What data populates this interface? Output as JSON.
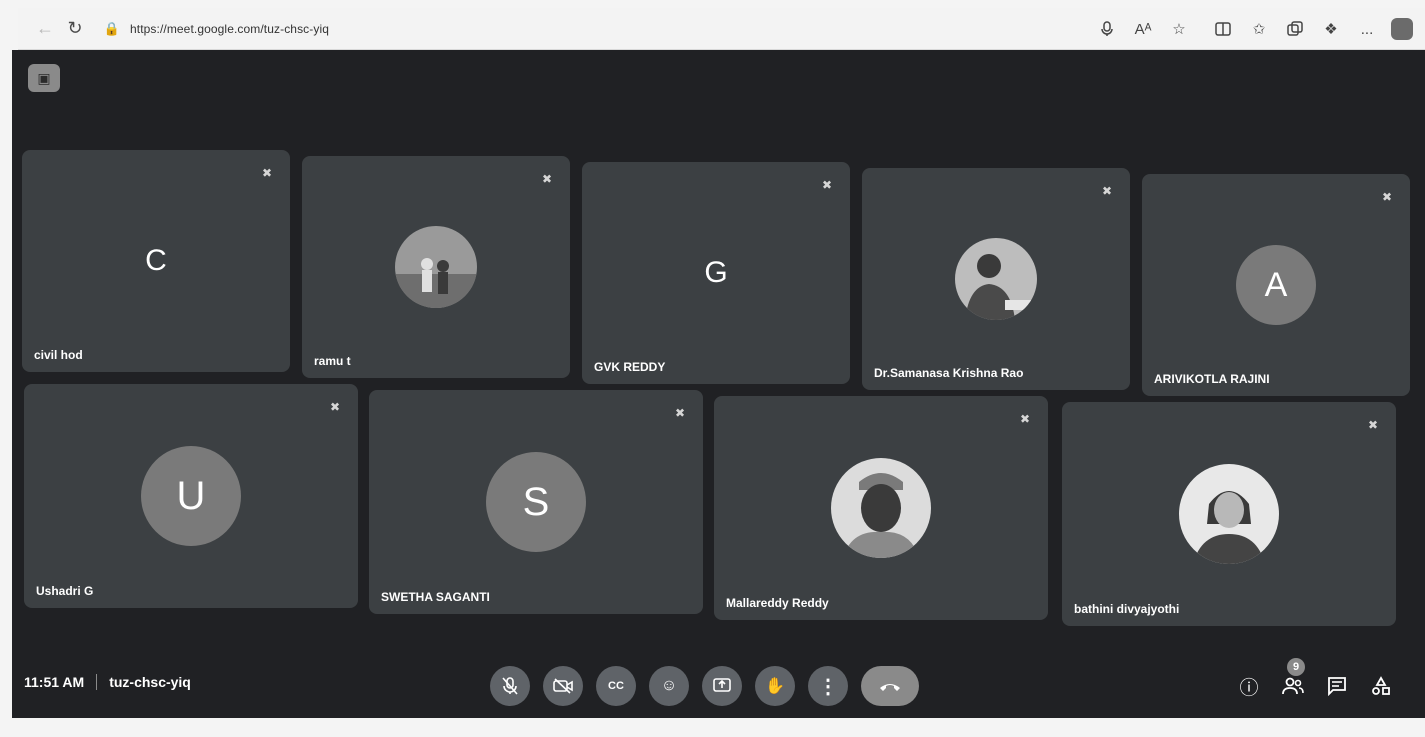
{
  "browser": {
    "url": "https://meet.google.com/tuz-chsc-yiq",
    "icons": [
      "back-icon",
      "reload-icon",
      "lock-icon",
      "mic-icon",
      "read-aloud-icon",
      "favorite-icon",
      "split-screen-icon",
      "favorites-icon",
      "collections-icon",
      "extensions-icon",
      "more-icon",
      "profile-icon"
    ],
    "read_aloud_label": "Aᴬ",
    "more_label": "..."
  },
  "meet": {
    "participants": [
      {
        "name": "civil hod",
        "initial": "C",
        "tile_style": "letter",
        "muted": true
      },
      {
        "name": "ramu t",
        "initial": "",
        "tile_style": "photo",
        "muted": true
      },
      {
        "name": "GVK REDDY",
        "initial": "G",
        "tile_style": "letter",
        "muted": true
      },
      {
        "name": "Dr.Samanasa Krishna Rao",
        "initial": "",
        "tile_style": "photo",
        "muted": true
      },
      {
        "name": "ARIVIKOTLA RAJINI",
        "initial": "A",
        "tile_style": "avatar",
        "muted": true
      },
      {
        "name": "Ushadri G",
        "initial": "U",
        "tile_style": "avatar",
        "muted": true
      },
      {
        "name": "SWETHA SAGANTI",
        "initial": "S",
        "tile_style": "avatar",
        "muted": true
      },
      {
        "name": "Mallareddy Reddy",
        "initial": "",
        "tile_style": "photo",
        "muted": true
      },
      {
        "name": "bathini divyajyothi",
        "initial": "",
        "tile_style": "photo",
        "muted": true
      }
    ],
    "time": "11:51 AM",
    "meeting_code": "tuz-chsc-yiq",
    "controls": [
      "mic-off-icon",
      "camera-off-icon",
      "captions-icon",
      "emoji-icon",
      "present-icon",
      "raise-hand-icon",
      "more-options-icon",
      "end-call-icon"
    ],
    "captions_label": "CC",
    "more_options_label": "⋮",
    "right_tools": [
      "info-icon",
      "people-icon",
      "chat-icon",
      "activities-icon"
    ],
    "people_badge": "9"
  }
}
